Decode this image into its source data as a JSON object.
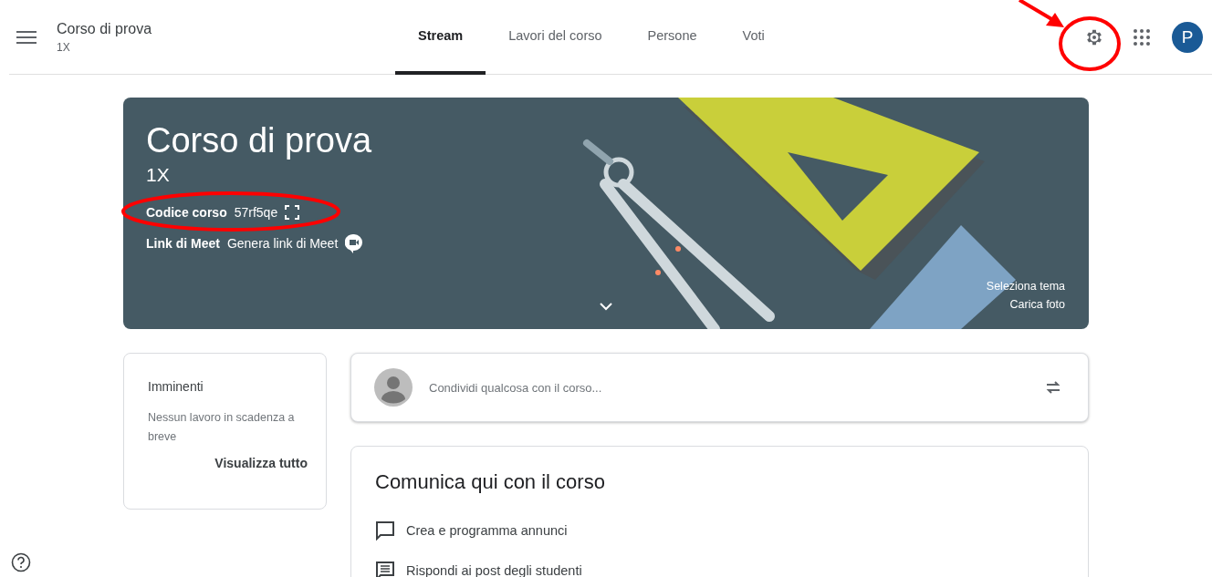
{
  "header": {
    "title": "Corso di prova",
    "subtitle": "1X",
    "avatar_letter": "P"
  },
  "tabs": [
    {
      "label": "Stream",
      "selected": true
    },
    {
      "label": "Lavori del corso",
      "selected": false
    },
    {
      "label": "Persone",
      "selected": false
    },
    {
      "label": "Voti",
      "selected": false
    }
  ],
  "banner": {
    "title": "Corso di prova",
    "section": "1X",
    "code_label": "Codice corso",
    "code": "57rf5qe",
    "meet_label": "Link di Meet",
    "meet_link": "Genera link di Meet",
    "theme_link": "Seleziona tema",
    "upload_link": "Carica foto"
  },
  "upcoming": {
    "title": "Imminenti",
    "message": "Nessun lavoro in scadenza a breve",
    "link": "Visualizza tutto"
  },
  "share": {
    "placeholder": "Condividi qualcosa con il corso..."
  },
  "communicate": {
    "title": "Comunica qui con il corso",
    "items": [
      {
        "kind": "announce",
        "label": "Crea e programma annunci"
      },
      {
        "kind": "reply",
        "label": "Rispondi ai post degli studenti"
      }
    ]
  }
}
